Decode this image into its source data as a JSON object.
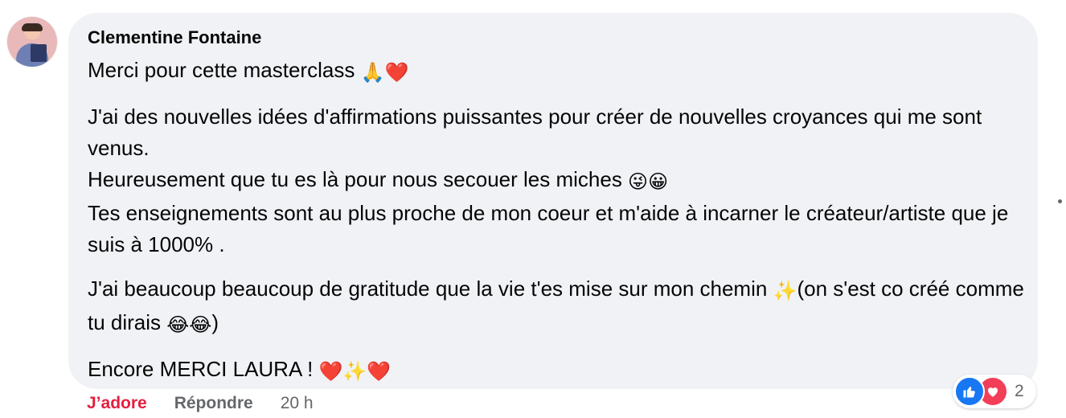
{
  "comment": {
    "author": "Clementine Fontaine",
    "paragraphs": [
      [
        {
          "text": "Merci pour cette masterclass ",
          "emoji": "🙏❤️"
        }
      ],
      [
        {
          "text": "J'ai des nouvelles idées d'affirmations puissantes pour créer de nouvelles croyances qui me sont venus."
        },
        {
          "text": "Heureusement que tu es là pour nous secouer les miches ",
          "emoji": "😜😀"
        },
        {
          "text": "Tes enseignements sont au plus proche de mon coeur et m'aide à incarner le créateur/artiste que je suis à 1000% ."
        }
      ],
      [
        {
          "text": "J'ai beaucoup beaucoup de gratitude que la vie t'es mise sur mon chemin ",
          "emoji": "✨",
          "after": "(on s'est co créé comme tu dirais ",
          "emoji2": "😂😂",
          "after2": ")"
        }
      ],
      [
        {
          "text": "Encore MERCI LAURA ! ",
          "emoji": "❤️✨❤️"
        }
      ]
    ]
  },
  "actions": {
    "love_label": "J’adore",
    "reply_label": "Répondre",
    "timestamp": "20 h"
  },
  "reactions": {
    "count": "2",
    "icons": [
      "like-icon",
      "heart-icon"
    ]
  },
  "colors": {
    "bubble": "#f0f2f5",
    "love": "#e41e3f",
    "like": "#1877f2",
    "heart": "#f33e58",
    "muted": "#65676b"
  }
}
